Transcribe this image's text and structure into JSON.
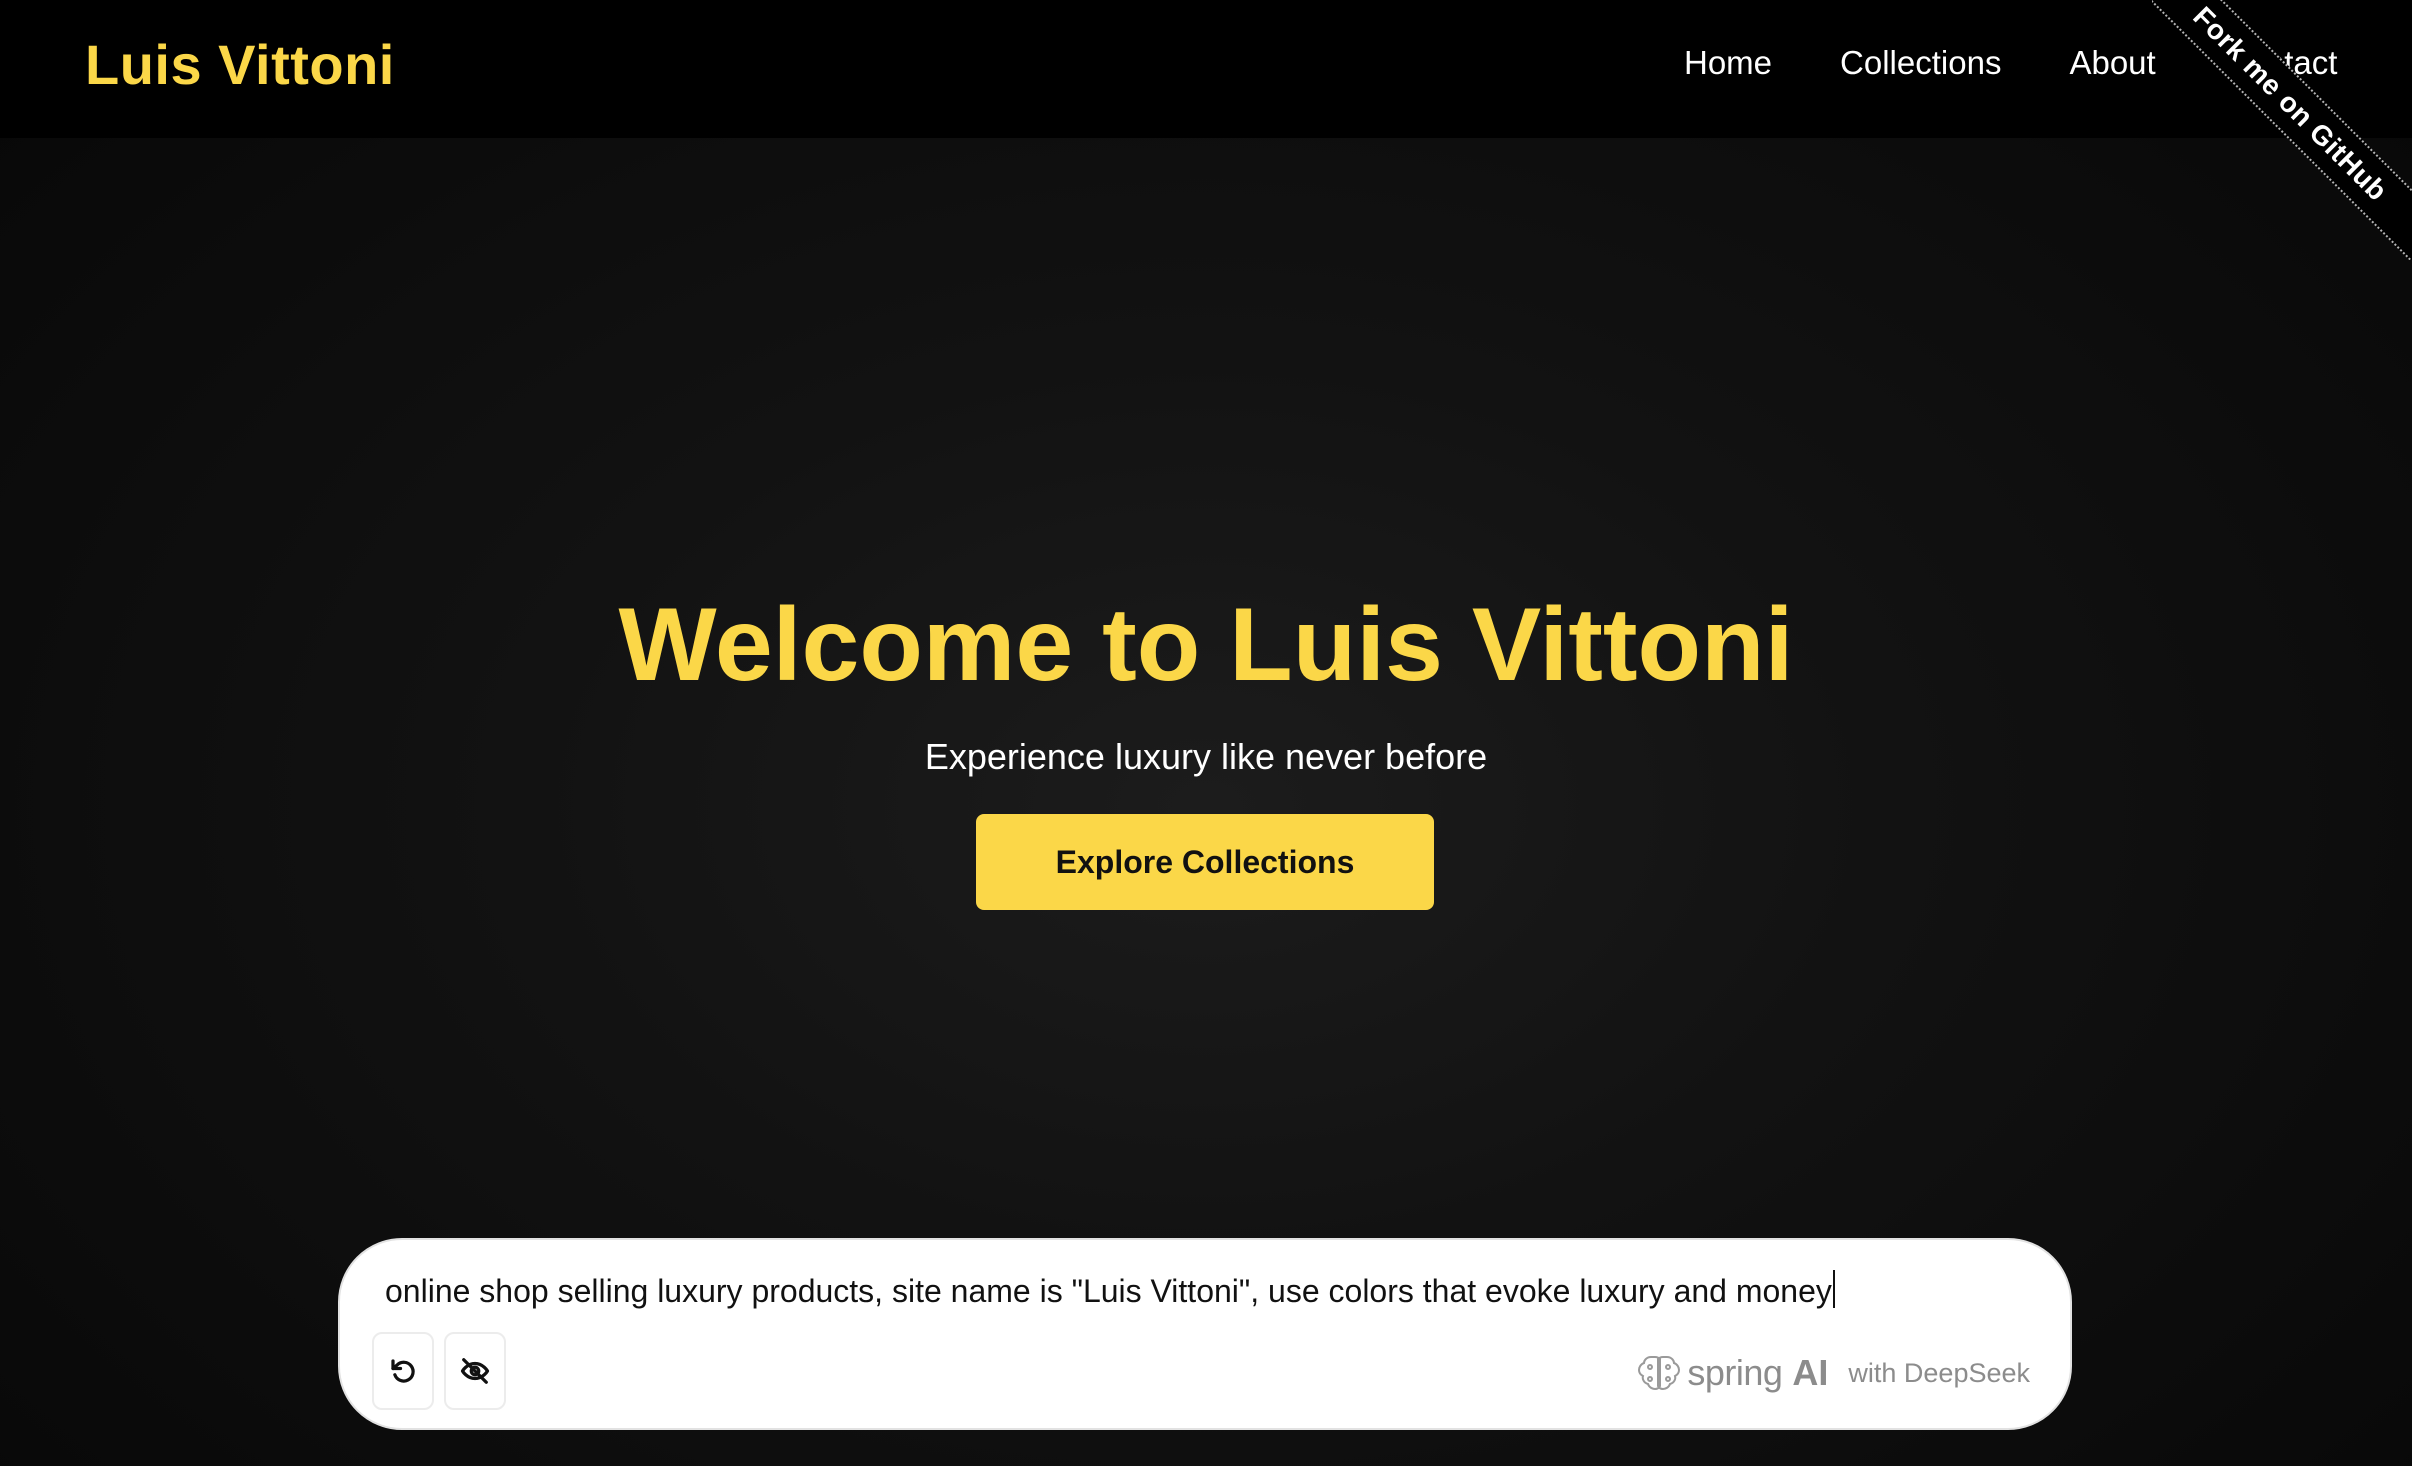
{
  "brand": {
    "name": "Luis Vittoni",
    "accent_color": "#fbd748"
  },
  "nav": {
    "items": [
      {
        "label": "Home"
      },
      {
        "label": "Collections"
      },
      {
        "label": "About"
      },
      {
        "label": "Contact"
      }
    ]
  },
  "ribbon": {
    "label": "Fork me on GitHub"
  },
  "hero": {
    "title": "Welcome to Luis Vittoni",
    "subtitle": "Experience luxury like never before",
    "cta_label": "Explore Collections"
  },
  "prompt": {
    "value": "online shop selling luxury products, site name is \"Luis Vittoni\", use colors that evoke luxury and money",
    "reset_icon": "rotate-ccw-icon",
    "hide_icon": "eye-off-icon",
    "powered_spring": "spring",
    "powered_ai": "AI",
    "powered_with": "with DeepSeek"
  }
}
